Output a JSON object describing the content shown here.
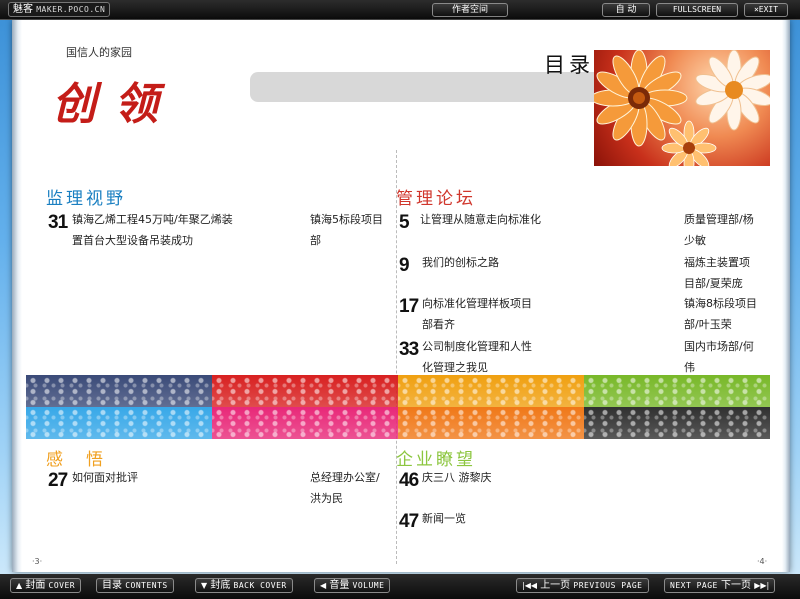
{
  "window": {
    "brand": "魅客",
    "brand_sub": "MAKER.POCO.CN",
    "author_space": "作者空间",
    "auto": "自 动",
    "fullscreen": "FULLSCREEN",
    "exit": "EXIT"
  },
  "header": {
    "tagline": "国信人的家园",
    "logo": "创领",
    "toc_title": "目录"
  },
  "sections": {
    "monitor": {
      "title": "监理视野",
      "color": "#1a7fc1",
      "items": [
        {
          "page": "31",
          "title_line1": "镇海乙烯工程45万吨/年聚乙烯装",
          "title_line2": "置首台大型设备吊装成功",
          "dept_line1": "镇海5标段项目",
          "dept_line2": "部"
        }
      ]
    },
    "management": {
      "title": "管理论坛",
      "color": "#d0362c",
      "items": [
        {
          "page": "5",
          "title_line1": "让管理从随意走向标准化",
          "title_line2": "",
          "dept_line1": "质量管理部/杨",
          "dept_line2": "少敏"
        },
        {
          "page": "9",
          "title_line1": "我们的创标之路",
          "title_line2": "",
          "dept_line1": "福炼主装置项",
          "dept_line2": "目部/夏荣庞"
        },
        {
          "page": "17",
          "title_line1": "向标准化管理样板项目",
          "title_line2": "部看齐",
          "dept_line1": "镇海8标段项目",
          "dept_line2": "部/叶玉荣"
        },
        {
          "page": "33",
          "title_line1": "公司制度化管理和人性",
          "title_line2": "化管理之我见",
          "dept_line1": "国内市场部/何",
          "dept_line2": "伟"
        }
      ]
    },
    "feelings": {
      "title": "感　悟",
      "color": "#f0a020",
      "items": [
        {
          "page": "27",
          "title_line1": "如何面对批评",
          "title_line2": "",
          "dept_line1": "总经理办公室/",
          "dept_line2": "洪为民"
        }
      ]
    },
    "outlook": {
      "title": "企业瞭望",
      "color": "#8cc63f",
      "items": [
        {
          "page": "46",
          "title_line1": "庆三八 游黎庆",
          "title_line2": "",
          "dept_line1": "",
          "dept_line2": ""
        },
        {
          "page": "47",
          "title_line1": "新闻一览",
          "title_line2": "",
          "dept_line1": "",
          "dept_line2": ""
        }
      ]
    }
  },
  "strip_colors": [
    "#3a4a78",
    "#d82020",
    "#f0a010",
    "#78b828",
    "#38a8e8",
    "#e82878",
    "#f07818",
    "#303030"
  ],
  "page_numbers": {
    "left": "·3·",
    "right": "·4·"
  },
  "footer": {
    "cover": "封面",
    "cover_en": "COVER",
    "contents": "目录",
    "contents_en": "CONTENTS",
    "back_cover": "封底",
    "back_cover_en": "BACK COVER",
    "volume": "音量",
    "volume_en": "VOLUME",
    "prev": "上一页",
    "prev_en": "PREVIOUS PAGE",
    "next_en": "NEXT PAGE",
    "next": "下一页"
  }
}
